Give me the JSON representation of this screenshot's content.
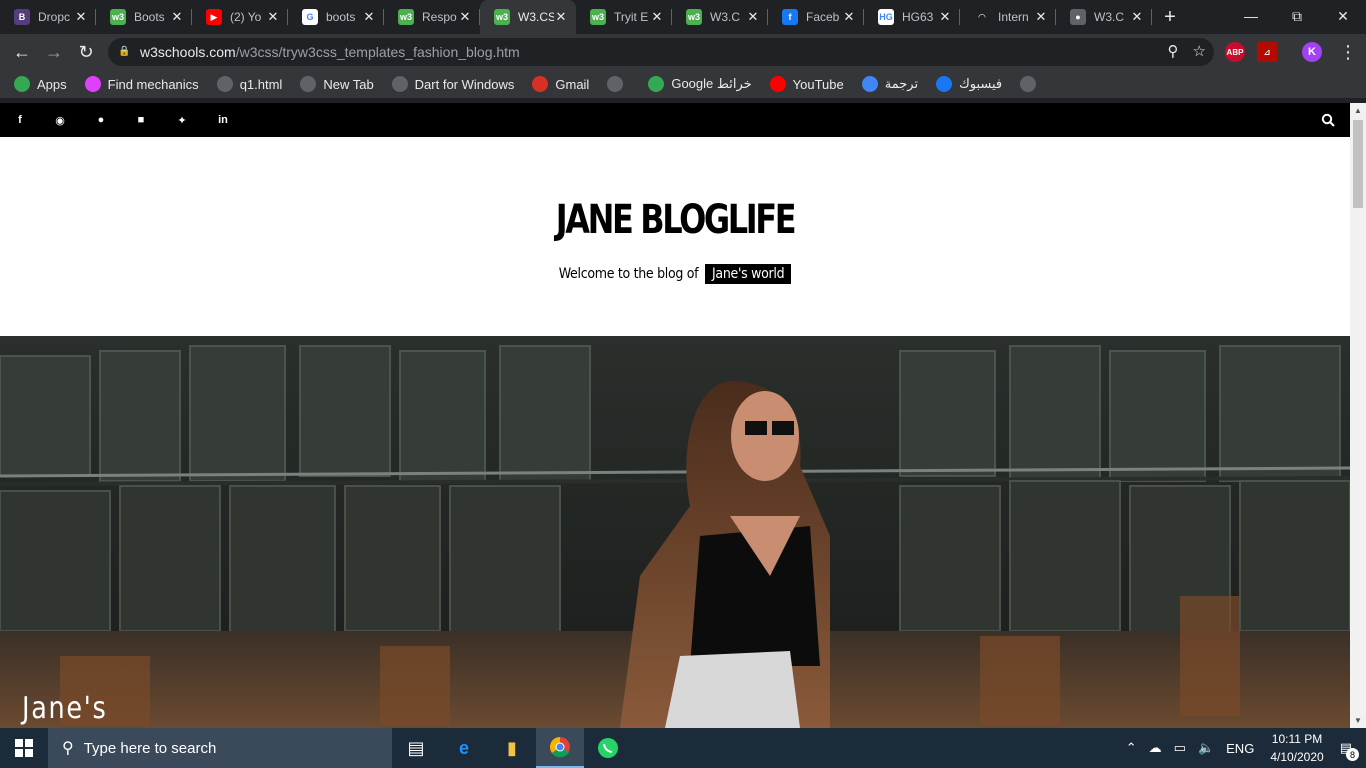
{
  "browser": {
    "tabs": [
      {
        "title": "Dropc",
        "favicon": "bootstrap-icon",
        "color": "#563d7c",
        "glyph": "B"
      },
      {
        "title": "Boots",
        "favicon": "w3schools-icon",
        "color": "#4caf50",
        "glyph": "w3"
      },
      {
        "title": "(2) Yo",
        "favicon": "youtube-icon",
        "color": "#ff0000",
        "glyph": "▶"
      },
      {
        "title": "boots",
        "favicon": "google-icon",
        "color": "#ffffff",
        "glyph": "G"
      },
      {
        "title": "Respo",
        "favicon": "w3schools-icon",
        "color": "#4caf50",
        "glyph": "w3"
      },
      {
        "title": "W3.CS",
        "favicon": "w3schools-icon",
        "color": "#4caf50",
        "glyph": "w3",
        "active": true
      },
      {
        "title": "Tryit E",
        "favicon": "w3schools-icon",
        "color": "#4caf50",
        "glyph": "w3"
      },
      {
        "title": "W3.C",
        "favicon": "w3schools-icon",
        "color": "#4caf50",
        "glyph": "w3"
      },
      {
        "title": "Faceb",
        "favicon": "facebook-icon",
        "color": "#1877f2",
        "glyph": "f"
      },
      {
        "title": "HG63",
        "favicon": "hg-icon",
        "color": "#ffffff",
        "glyph": "HG"
      },
      {
        "title": "Intern",
        "favicon": "speedtest-icon",
        "color": "#202124",
        "glyph": "◠"
      },
      {
        "title": "W3.C",
        "favicon": "globe-icon",
        "color": "#5f6368",
        "glyph": "●"
      }
    ],
    "new_tab": "+",
    "url_host": "w3schools.com",
    "url_path": "/w3css/tryw3css_templates_fashion_blog.htm",
    "extensions": [
      {
        "name": "adblock-plus-icon",
        "label": "ABP",
        "color": "#c70d2c"
      },
      {
        "name": "pdf-icon",
        "label": "⊿",
        "color": "#b30b00"
      },
      {
        "name": "profile-avatar",
        "label": "K",
        "color": "#a142f4"
      }
    ],
    "bookmarks": [
      {
        "label": "Apps",
        "icon": "apps-grid-icon",
        "color": "#34a853"
      },
      {
        "label": "Find mechanics",
        "icon": "mechanics-icon",
        "color": "#e040fb"
      },
      {
        "label": "q1.html",
        "icon": "globe-icon",
        "color": "#5f6368"
      },
      {
        "label": "New Tab",
        "icon": "globe-icon",
        "color": "#5f6368"
      },
      {
        "label": "Dart for Windows",
        "icon": "globe-icon",
        "color": "#5f6368"
      },
      {
        "label": "Gmail",
        "icon": "gmail-icon",
        "color": "#d93025"
      },
      {
        "label": "",
        "icon": "globe-icon",
        "color": "#5f6368"
      },
      {
        "label": "Google خرائط",
        "icon": "maps-icon",
        "color": "#34a853"
      },
      {
        "label": "YouTube",
        "icon": "youtube-icon",
        "color": "#ff0000"
      },
      {
        "label": "ترجمة",
        "icon": "translate-icon",
        "color": "#4285f4"
      },
      {
        "label": "فيسبوك",
        "icon": "facebook-icon",
        "color": "#1877f2"
      },
      {
        "label": "",
        "icon": "globe-icon",
        "color": "#5f6368"
      }
    ]
  },
  "page": {
    "social_icons": [
      "facebook-icon",
      "instagram-icon",
      "snapchat-icon",
      "flickr-icon",
      "twitter-icon",
      "linkedin-icon"
    ],
    "brand": "JANE BLOGLIFE",
    "tagline": "Welcome to the blog of",
    "tagline_highlight": "Jane's world",
    "hero_title": "Jane's"
  },
  "taskbar": {
    "search_placeholder": "Type here to search",
    "language": "ENG",
    "time": "10:11 PM",
    "date": "4/10/2020",
    "notifications": "8"
  }
}
